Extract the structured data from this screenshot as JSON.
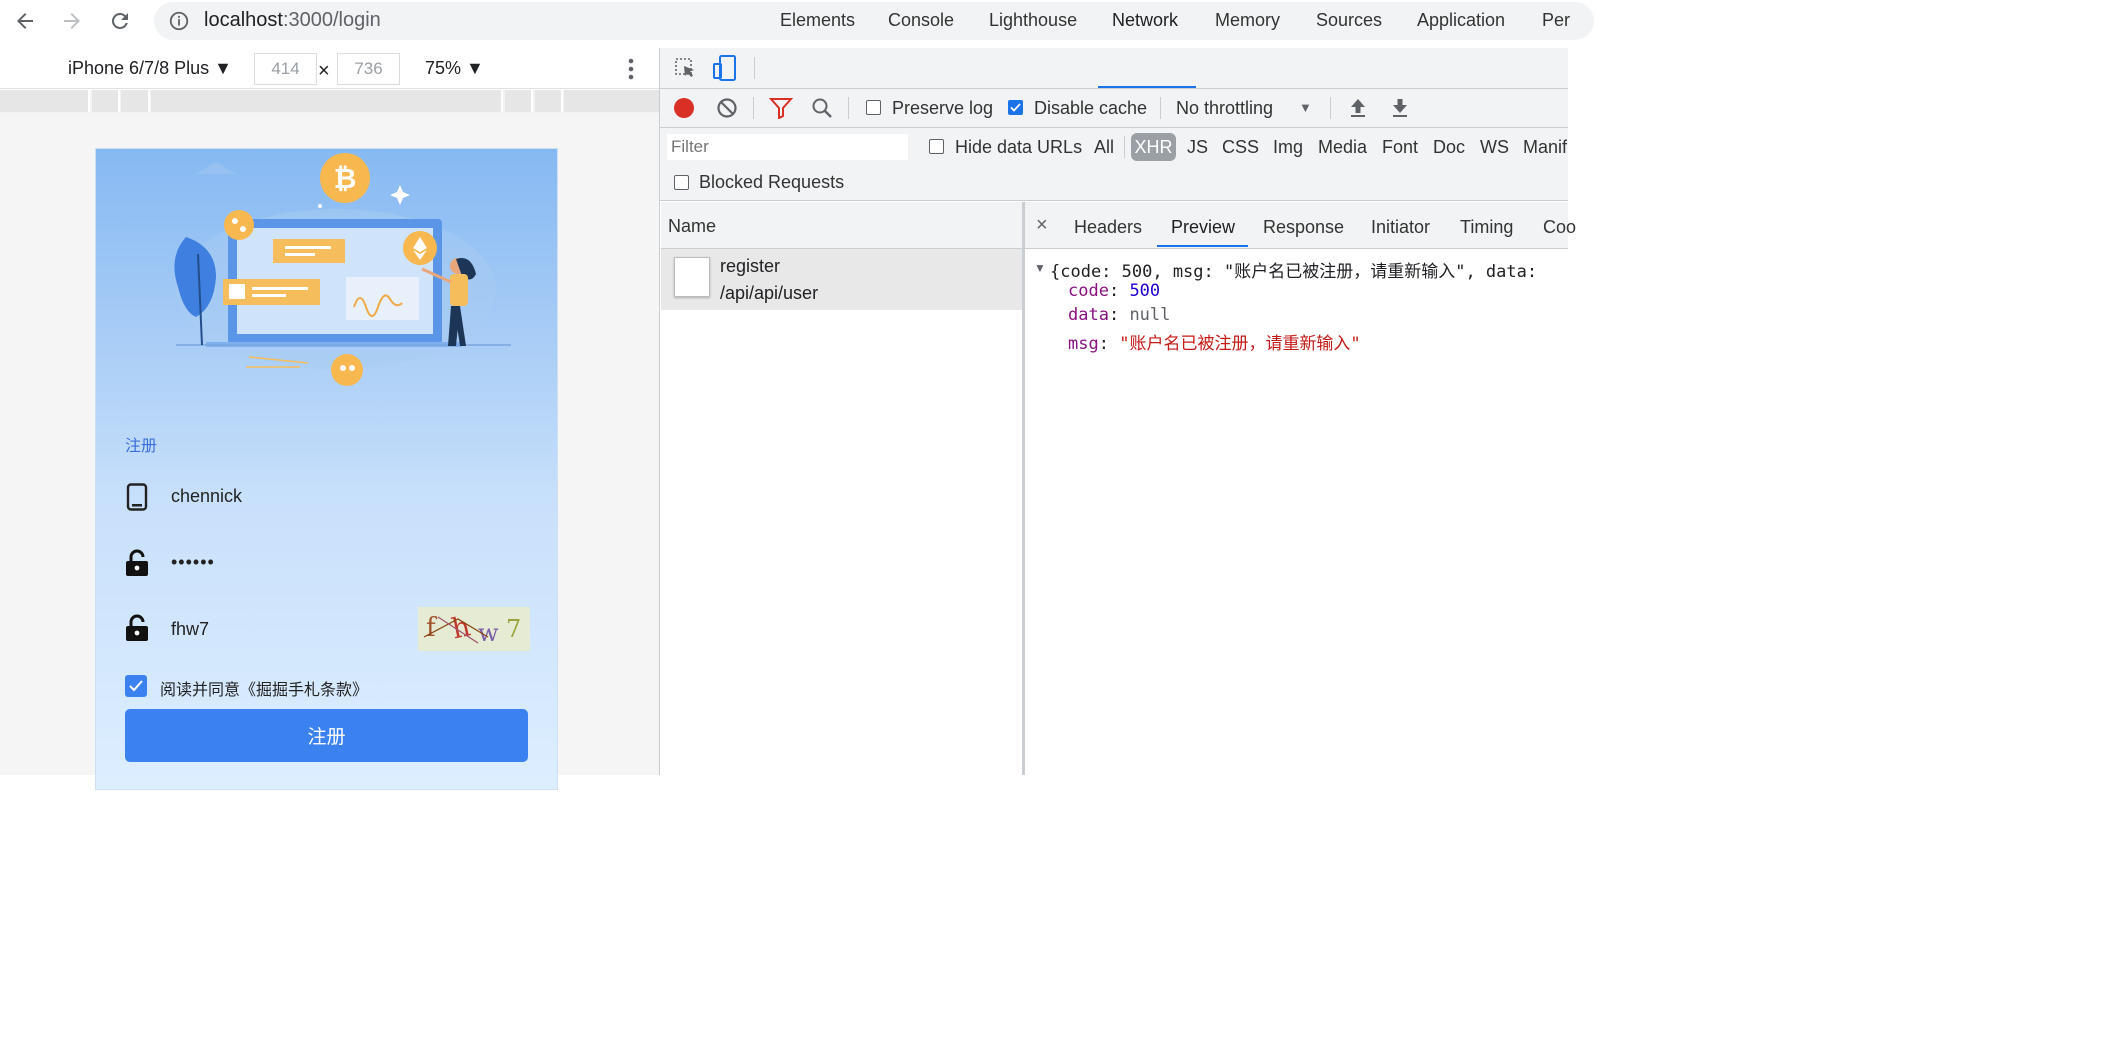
{
  "browser": {
    "url_host": "localhost",
    "url_path": ":3000/login"
  },
  "device_toolbar": {
    "device": "iPhone 6/7/8 Plus",
    "width": "414",
    "times": "×",
    "height": "736",
    "zoom": "75%"
  },
  "phone": {
    "heading": "注册",
    "username": "chennick",
    "password_mask": "••••••",
    "captcha_input": "fhw7",
    "captcha_chars": [
      "f",
      "h",
      "w",
      "7"
    ],
    "agree_text": "阅读并同意《掘掘手札条款》",
    "agree_checked": true,
    "submit_label": "注册"
  },
  "devtools": {
    "tabs": [
      "Elements",
      "Console",
      "Lighthouse",
      "Network",
      "Memory",
      "Sources",
      "Application",
      "Per"
    ],
    "active_tab": "Network",
    "toolbar": {
      "preserve_log": "Preserve log",
      "preserve_log_checked": false,
      "disable_cache": "Disable cache",
      "disable_cache_checked": true,
      "throttling": "No throttling"
    },
    "filter": {
      "placeholder": "Filter",
      "hide_data_urls": "Hide data URLs",
      "types": [
        "All",
        "XHR",
        "JS",
        "CSS",
        "Img",
        "Media",
        "Font",
        "Doc",
        "WS",
        "Manif"
      ],
      "active_type": "XHR",
      "blocked_requests": "Blocked Requests"
    },
    "name_header": "Name",
    "requests": [
      {
        "name": "register",
        "path": "/api/api/user"
      }
    ],
    "detail_tabs": [
      "Headers",
      "Preview",
      "Response",
      "Initiator",
      "Timing",
      "Coo"
    ],
    "active_detail_tab": "Preview",
    "preview": {
      "summary": "{code: 500, msg: \"账户名已被注册，请重新输入\", data:",
      "code_key": "code",
      "code_val": "500",
      "data_key": "data",
      "data_val": "null",
      "msg_key": "msg",
      "msg_val": "\"账户名已被注册，请重新输入\""
    }
  },
  "colors": {
    "accent": "#1a73e8",
    "button": "#3b82f0",
    "record": "#d93025"
  }
}
